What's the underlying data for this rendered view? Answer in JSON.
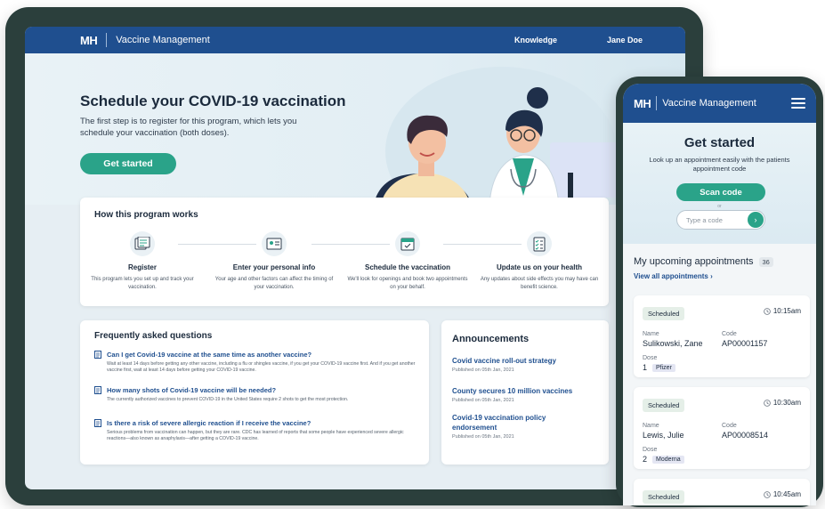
{
  "tablet": {
    "brand": "MH",
    "app_name": "Vaccine Management",
    "nav": {
      "knowledge": "Knowledge",
      "user": "Jane Doe"
    },
    "hero": {
      "title": "Schedule your COVID-19 vaccination",
      "text": "The first step is to register for this program, which lets you schedule your vaccination (both doses).",
      "cta": "Get started"
    },
    "how": {
      "title": "How this program works",
      "steps": [
        {
          "title": "Register",
          "desc": "This program lets you set up and track your vaccination.",
          "icon": "register-icon"
        },
        {
          "title": "Enter your personal info",
          "desc": "Your age and other factors  can affect the timing of your vaccination.",
          "icon": "personal-info-icon"
        },
        {
          "title": "Schedule the vaccination",
          "desc": "We'll look for openings and book two appointments on your behalf.",
          "icon": "calendar-icon"
        },
        {
          "title": "Update us on your health",
          "desc": "Any updates about side effects you may have can benefit science.",
          "icon": "checklist-icon"
        }
      ]
    },
    "faq": {
      "title": "Frequently asked questions",
      "items": [
        {
          "q": "Can I get Covid-19 vaccine at the same time as another vaccine?",
          "a": "Wait at least 14 days before getting any other vaccine, including a flu or shingles vaccine, if you get your COVID-19 vaccine first. And if you get another vaccine first, wait at least 14 days before getting your COVID-19 vaccine."
        },
        {
          "q": "How many shots of Covid-19 vaccine will be needed?",
          "a": "The currently authorized vaccines to prevent COVID-19 in the United States require 2 shots to get the most protection."
        },
        {
          "q": "Is there a risk of severe allergic reaction if I receive the vaccine?",
          "a": "Serious problems from vaccination can happen, but they are rare. CDC has learned of reports that some people have experienced severe allergic reactions—also known as anaphylaxis—after getting a COVID-19 vaccine."
        }
      ]
    },
    "announcements": {
      "title": "Announcements",
      "items": [
        {
          "title": "Covid vaccine roll-out strategy",
          "date": "Published on 05th Jan, 2021"
        },
        {
          "title": "County secures 10 million vaccines",
          "date": "Published on 05th Jan, 2021"
        },
        {
          "title": "Covid-19 vaccination  policy endorsement",
          "date": "Published on 05th Jan, 2021"
        }
      ]
    }
  },
  "phone": {
    "brand": "MH",
    "app_name": "Vaccine Management",
    "hero": {
      "title": "Get started",
      "subtitle": "Look up an appointment easily with the patients appointment code",
      "scan": "Scan code",
      "or": "or",
      "code_placeholder": "Type a code"
    },
    "list": {
      "title": "My upcoming appointments",
      "count": "36",
      "view_all": "View all appointments  ›"
    },
    "appointments": [
      {
        "status": "Scheduled",
        "time": "10:15am",
        "name_label": "Name",
        "name": "Sulikowski, Zane",
        "code_label": "Code",
        "code": "AP00001157",
        "dose_label": "Dose",
        "dose": "1",
        "vaccine": "Pfizer"
      },
      {
        "status": "Scheduled",
        "time": "10:30am",
        "name_label": "Name",
        "name": "Lewis, Julie",
        "code_label": "Code",
        "code": "AP00008514",
        "dose_label": "Dose",
        "dose": "2",
        "vaccine": "Moderna"
      },
      {
        "status": "Scheduled",
        "time": "10:45am"
      }
    ]
  },
  "colors": {
    "brand_blue": "#1f4f8f",
    "accent_green": "#2aa389",
    "device_frame": "#2b3f3c"
  }
}
